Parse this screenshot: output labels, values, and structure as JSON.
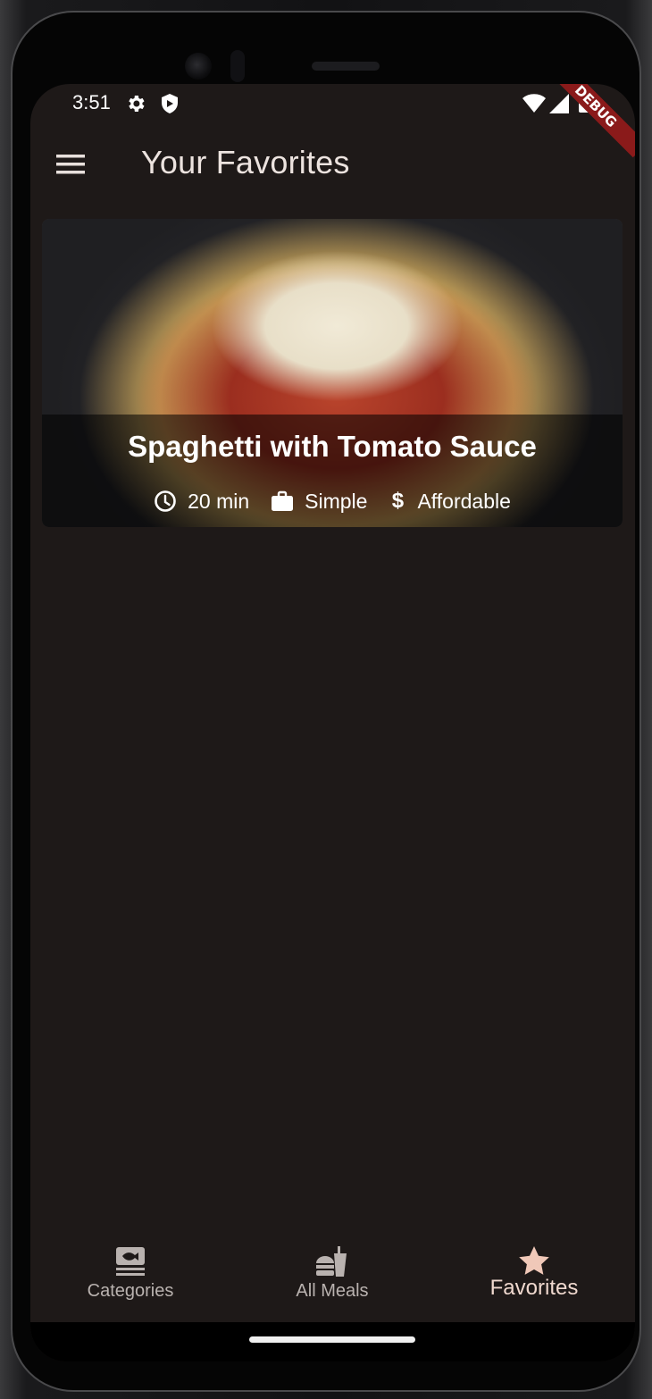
{
  "status_bar": {
    "time": "3:51",
    "icons": [
      "gear-icon",
      "shield-icon",
      "wifi-icon",
      "signal-icon",
      "battery-icon"
    ]
  },
  "debug_banner": "DEBUG",
  "app_bar": {
    "menu_icon": "menu-icon",
    "title": "Your Favorites"
  },
  "favorites": [
    {
      "title": "Spaghetti with Tomato Sauce",
      "duration": "20 min",
      "complexity": "Simple",
      "affordability": "Affordable",
      "icons": [
        "clock-icon",
        "briefcase-icon",
        "dollar-icon"
      ]
    }
  ],
  "bottom_nav": {
    "items": [
      {
        "label": "Categories",
        "icon": "set-meal-icon",
        "active": false
      },
      {
        "label": "All Meals",
        "icon": "fastfood-icon",
        "active": false
      },
      {
        "label": "Favorites",
        "icon": "star-icon",
        "active": true
      }
    ]
  },
  "colors": {
    "background": "#1e1918",
    "title_text": "#ece3df",
    "active_nav": "#f0d9cf",
    "inactive_nav": "#b9b2af",
    "debug_banner": "#8a1a1a"
  }
}
